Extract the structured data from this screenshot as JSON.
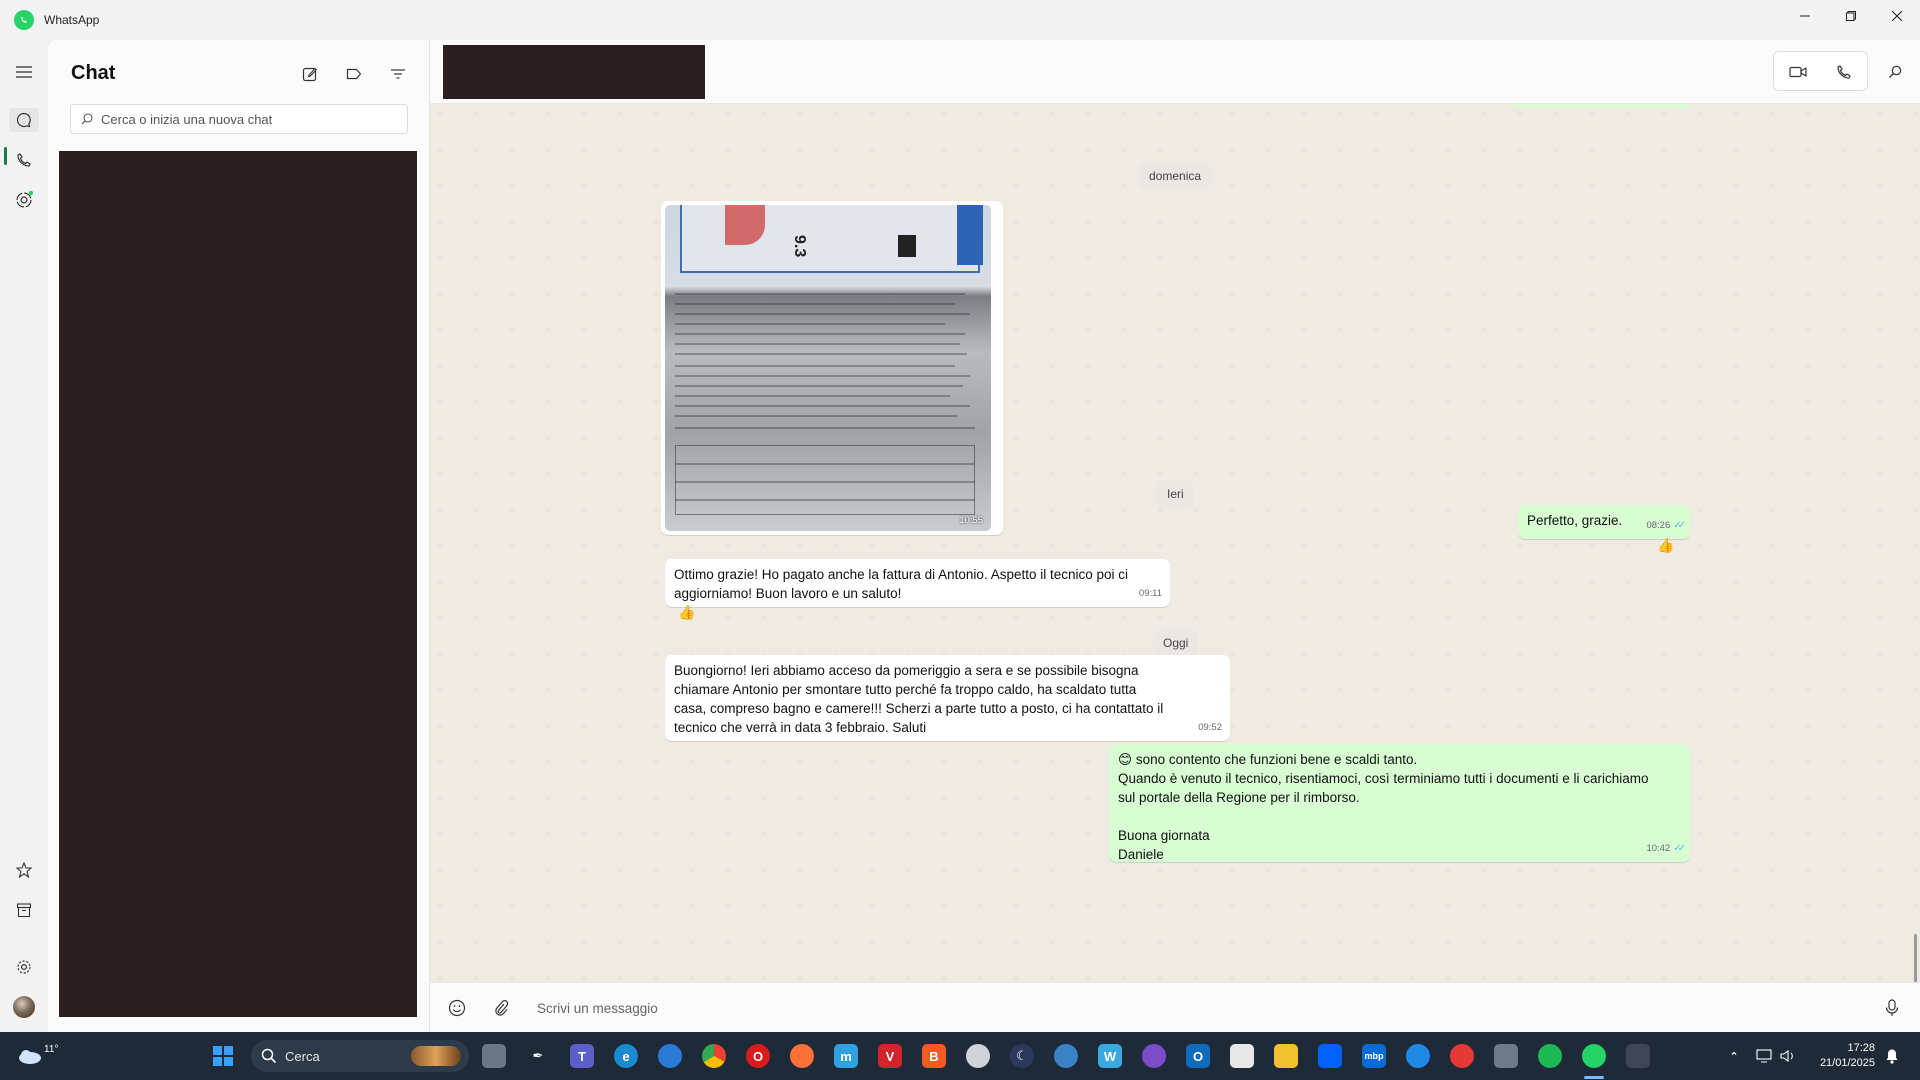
{
  "window": {
    "title": "WhatsApp",
    "controls": [
      "minimize-icon",
      "maximize-icon",
      "close-icon"
    ]
  },
  "rail": {
    "items": [
      {
        "name": "menu-icon"
      },
      {
        "name": "chats-icon",
        "active": true
      },
      {
        "name": "calls-icon"
      },
      {
        "name": "status-icon",
        "has_dot": true
      },
      {
        "name": "starred-icon"
      },
      {
        "name": "archive-icon"
      },
      {
        "name": "settings-icon"
      },
      {
        "name": "profile-avatar"
      }
    ]
  },
  "chat_list": {
    "heading": "Chat",
    "search_placeholder": "Cerca o inizia una nuova chat",
    "header_icons": [
      "new-chat-icon",
      "label-icon",
      "filter-icon"
    ]
  },
  "conversation": {
    "header_icons": [
      "video-call-icon",
      "voice-call-icon",
      "search-icon"
    ],
    "date_labels": {
      "sunday": "domenica",
      "yesterday": "Ieri",
      "today": "Oggi"
    },
    "messages": [
      {
        "id": "photo",
        "direction": "incoming",
        "type": "image",
        "time": "10:55"
      },
      {
        "id": "m1",
        "direction": "outgoing",
        "text": "Perfetto, grazie.",
        "time": "08:26",
        "read": true,
        "reaction": "👍"
      },
      {
        "id": "m2",
        "direction": "incoming",
        "text": "Ottimo grazie! Ho pagato anche la fattura di Antonio. Aspetto il tecnico poi ci aggiorniamo! Buon lavoro e un saluto!",
        "time": "09:11",
        "reaction": "👍"
      },
      {
        "id": "m3",
        "direction": "incoming",
        "text": "Buongiorno! Ieri abbiamo acceso da pomeriggio a sera e se possibile bisogna chiamare Antonio per smontare tutto perché fa troppo caldo, ha scaldato tutta casa, compreso bagno e camere!!! Scherzi a parte tutto a posto, ci ha contattato il tecnico che verrà in data 3 febbraio. Saluti",
        "time": "09:52"
      },
      {
        "id": "m4",
        "direction": "outgoing",
        "text": "😊 sono contento che funzioni bene e scaldi tanto.\nQuando è venuto il tecnico, risentiamoci, così terminiamo tutti i documenti e li carichiamo sul portale della Regione per il rimborso.\n\nBuona giornata\nDaniele",
        "time": "10:42",
        "read": true
      }
    ]
  },
  "composer": {
    "placeholder": "Scrivi un messaggio",
    "icons": [
      "emoji-icon",
      "attach-icon",
      "microphone-icon"
    ]
  },
  "taskbar": {
    "weather_temp": "11°",
    "search_label": "Cerca",
    "clock_time": "17:28",
    "clock_date": "21/01/2025"
  },
  "colors": {
    "accent": "#25d366",
    "outgoing_bubble": "#d9fdd3",
    "incoming_bubble": "#ffffff",
    "chat_bg": "#efeae2",
    "read_ticks": "#53bdeb"
  }
}
